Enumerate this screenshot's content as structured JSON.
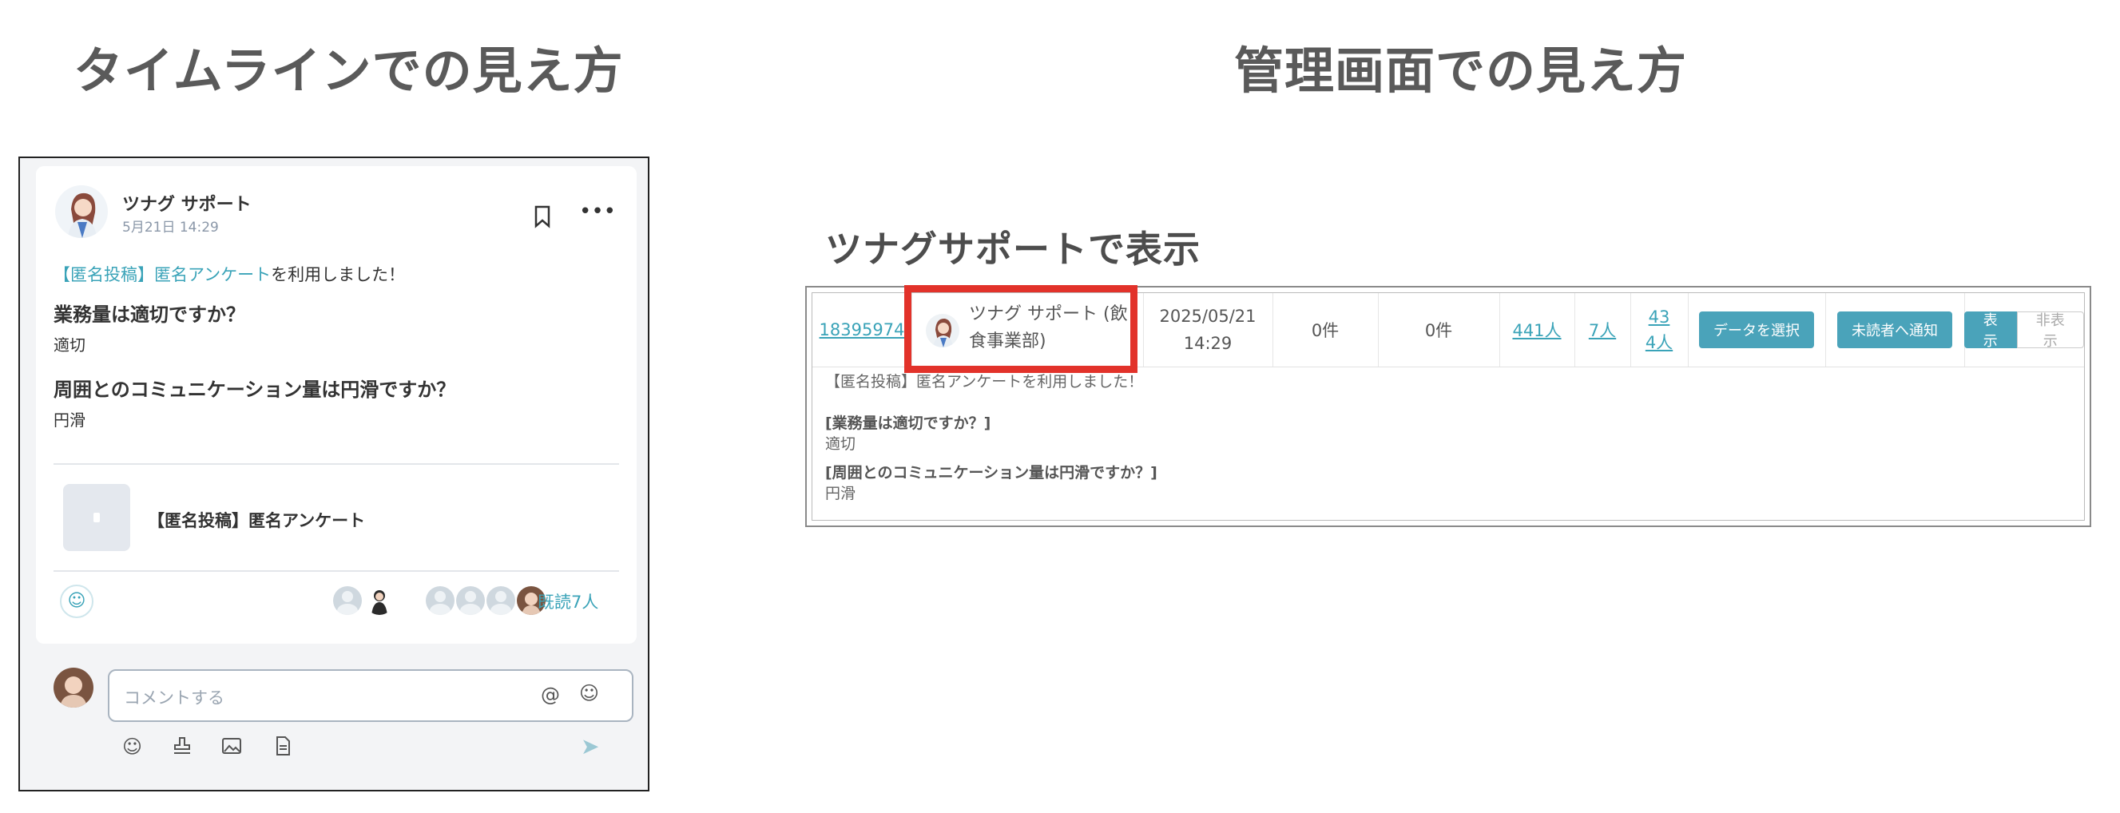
{
  "headings": {
    "left": "タイムラインでの見え方",
    "right": "管理画面での見え方",
    "sub": "ツナグサポートで表示"
  },
  "timeline": {
    "author": "ツナグ サポート",
    "date": "5月21日 14:29",
    "anon_tag": "【匿名投稿】",
    "anon_link": "匿名アンケート",
    "anon_suffix": "を利用しました！",
    "q1": "業務量は適切ですか？",
    "a1": "適切",
    "q2": "周囲とのコミュニケーション量は円滑ですか？",
    "a2": "円滑",
    "link_title": "【匿名投稿】匿名アンケート",
    "read_count": "既読7人",
    "comment_placeholder": "コメントする",
    "icons": {
      "bookmark": "bookmark-icon",
      "more": "more-icon",
      "at": "at-icon",
      "emoji": "emoji-icon",
      "stamp": "stamp-icon",
      "image": "image-icon",
      "file": "file-icon",
      "send": "send-icon",
      "reaction": "add-reaction-icon"
    }
  },
  "admin": {
    "row": {
      "id": "18395974",
      "poster": "ツナグ サポート (飲食事業部)",
      "date": "2025/05/21",
      "time": "14:29",
      "count1": "0件",
      "count2": "0件",
      "target": "441人",
      "read": "7人",
      "unread": "434人",
      "btn_data": "データを選択",
      "btn_notify": "未読者へ通知",
      "btn_show": "表示",
      "btn_hide": "非表示"
    },
    "body": {
      "line1": "【匿名投稿】匿名アンケートを利用しました！",
      "q1": "[業務量は適切ですか？]",
      "a1": "適切",
      "q2": "[周囲とのコミュニケーション量は円滑ですか？]",
      "a2": "円滑"
    }
  },
  "colors": {
    "accent": "#3aa3b8",
    "highlight": "#e2322a",
    "button": "#4aa3ba"
  }
}
